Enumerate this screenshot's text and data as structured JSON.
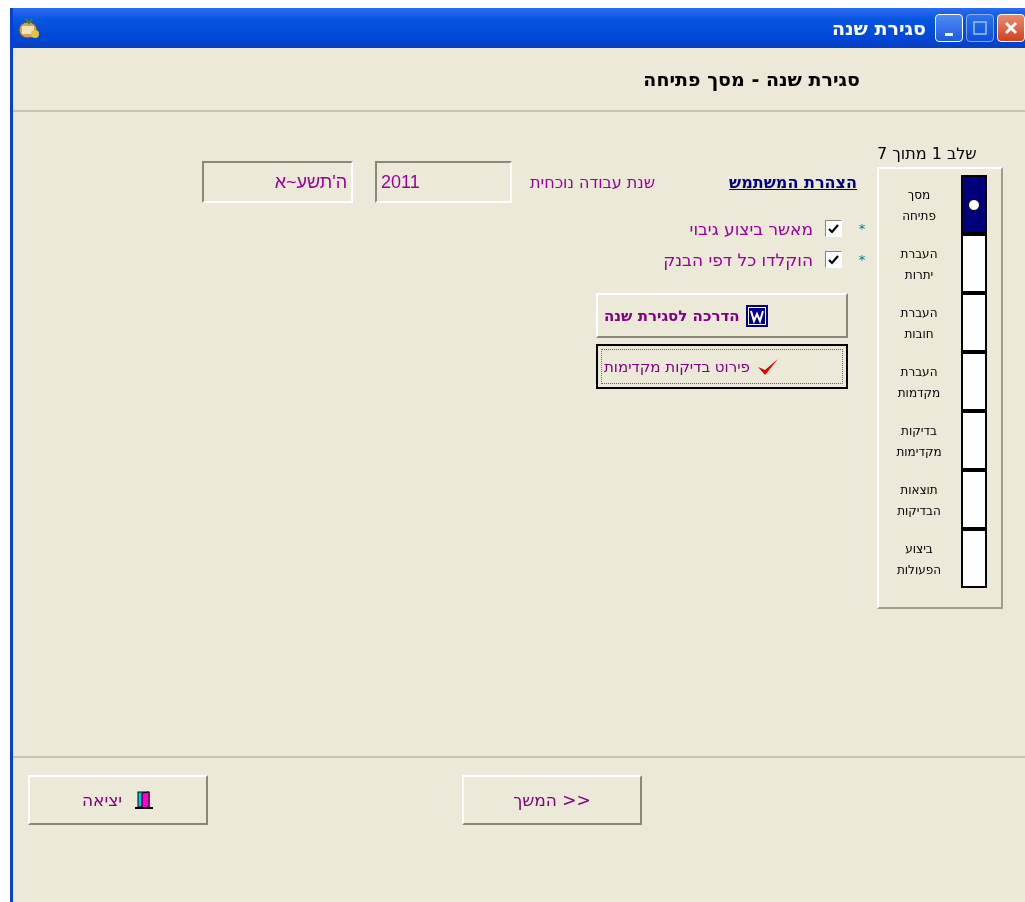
{
  "window": {
    "title": "סגירת שנה",
    "controls": [
      {
        "kind": "minimize",
        "disabled": false
      },
      {
        "kind": "maximize",
        "disabled": true
      },
      {
        "kind": "close",
        "disabled": false
      }
    ]
  },
  "header": {
    "title": "סגירת שנה - מסך פתיחה"
  },
  "stepper": {
    "caption": "שלב 1 מתוך 7",
    "steps": [
      {
        "label": "מסך פתיחה",
        "selected": true
      },
      {
        "label": "העברת יתרות",
        "selected": false
      },
      {
        "label": "העברת חובות",
        "selected": false
      },
      {
        "label": "העברת מקדמות",
        "selected": false
      },
      {
        "label": "בדיקות מקדימות",
        "selected": false
      },
      {
        "label": "תוצאות הבדיקות",
        "selected": false
      },
      {
        "label": "ביצוע הפעולות",
        "selected": false
      }
    ]
  },
  "declaration_link": "הצהרת המשתמש",
  "work_year": {
    "label": "שנת עבודה נוכחית",
    "value": "2011",
    "hebrew_value": "ה'תשע~א"
  },
  "confirmations": [
    {
      "marker": "*",
      "label": "מאשר ביצוע גיבוי",
      "checked": true
    },
    {
      "marker": "*",
      "label": "הוקלדו כל דפי הבנק",
      "checked": true
    }
  ],
  "actions": [
    {
      "kind": "word",
      "label": "הדרכה לסגירת שנה",
      "focused": false
    },
    {
      "kind": "check",
      "label": "פירוט בדיקות מקדימות",
      "focused": true
    }
  ],
  "footer": {
    "exit": "יציאה",
    "next": "המשך >>"
  }
}
